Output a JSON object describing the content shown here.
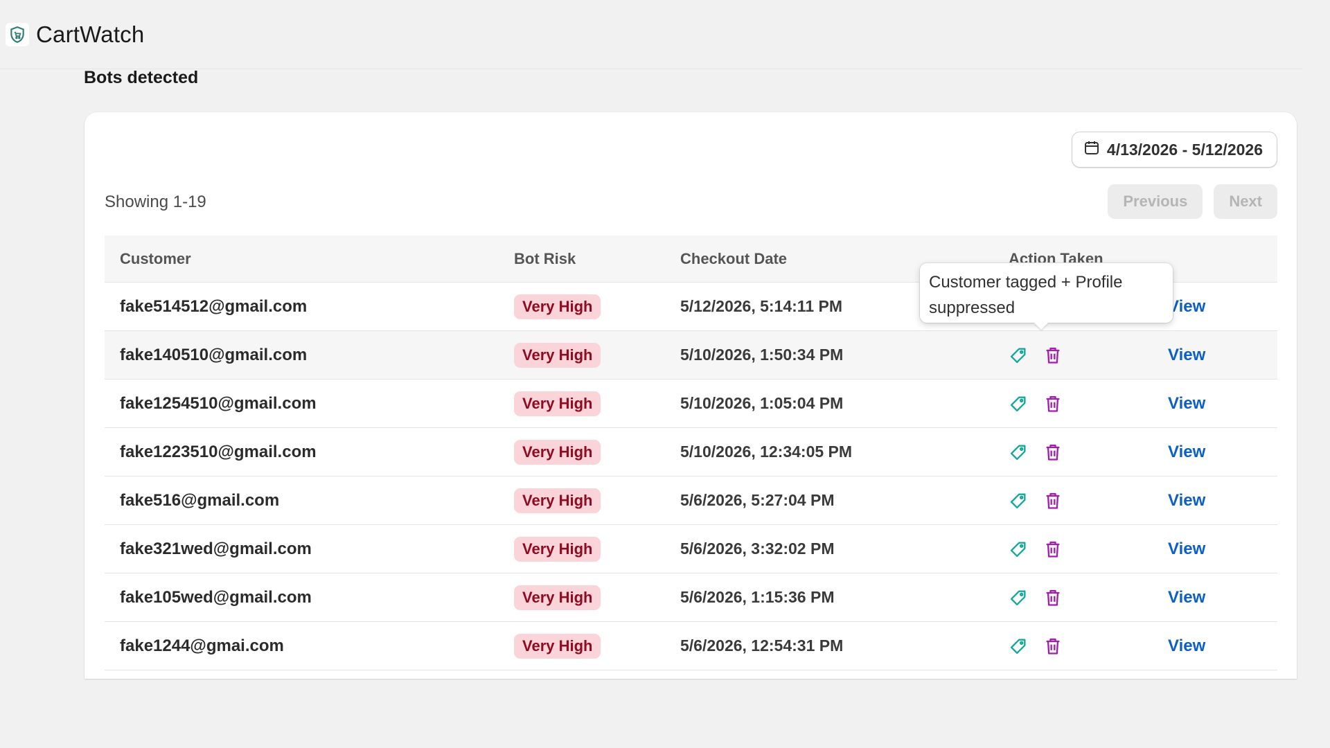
{
  "app": {
    "title": "CartWatch"
  },
  "page": {
    "title": "Bots detected"
  },
  "filters": {
    "date_range": "4/13/2026 - 5/12/2026"
  },
  "pagination": {
    "showing": "Showing 1-19",
    "previous_label": "Previous",
    "next_label": "Next"
  },
  "table": {
    "columns": [
      "Customer",
      "Bot Risk",
      "Checkout Date",
      "Action Taken"
    ],
    "rows": [
      {
        "email": "fake514512@gmail.com",
        "risk": "Very High",
        "date": "5/12/2026, 5:14:11 PM",
        "view": "View"
      },
      {
        "email": "fake140510@gmail.com",
        "risk": "Very High",
        "date": "5/10/2026, 1:50:34 PM",
        "view": "View"
      },
      {
        "email": "fake1254510@gmail.com",
        "risk": "Very High",
        "date": "5/10/2026, 1:05:04 PM",
        "view": "View"
      },
      {
        "email": "fake1223510@gmail.com",
        "risk": "Very High",
        "date": "5/10/2026, 12:34:05 PM",
        "view": "View"
      },
      {
        "email": "fake516@gmail.com",
        "risk": "Very High",
        "date": "5/6/2026, 5:27:04 PM",
        "view": "View"
      },
      {
        "email": "fake321wed@gmail.com",
        "risk": "Very High",
        "date": "5/6/2026, 3:32:02 PM",
        "view": "View"
      },
      {
        "email": "fake105wed@gmail.com",
        "risk": "Very High",
        "date": "5/6/2026, 1:15:36 PM",
        "view": "View"
      },
      {
        "email": "fake1244@gmai.com",
        "risk": "Very High",
        "date": "5/6/2026, 12:54:31 PM",
        "view": "View"
      }
    ]
  },
  "tooltip": {
    "text": "Customer tagged + Profile suppressed"
  },
  "icons": {
    "logo": "shield-cart-icon",
    "calendar": "calendar-icon",
    "tag": "tag-icon",
    "trash": "trash-icon"
  },
  "colors": {
    "tag_icon": "#14a89a",
    "trash_icon": "#a21caf",
    "badge_bg": "#fbd4d9",
    "badge_text": "#8e0b21",
    "link": "#0b5fc7"
  }
}
